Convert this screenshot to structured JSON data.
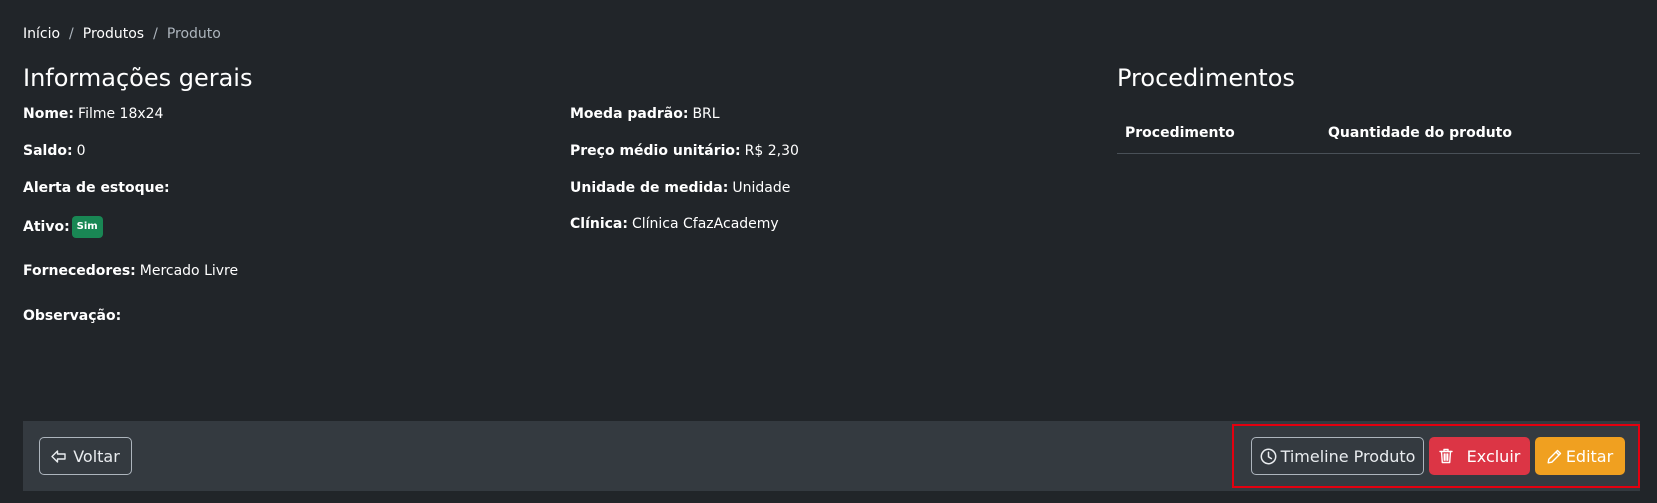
{
  "breadcrumb": {
    "items": [
      "Início",
      "Produtos"
    ],
    "current": "Produto",
    "separator": "/"
  },
  "general": {
    "title": "Informações gerais",
    "fields": {
      "nome": {
        "label": "Nome:",
        "value": "Filme 18x24"
      },
      "saldo": {
        "label": "Saldo:",
        "value": "0"
      },
      "alerta": {
        "label": "Alerta de estoque:",
        "value": ""
      },
      "ativo": {
        "label": "Ativo:",
        "badge": "Sim"
      },
      "fornecedores": {
        "label": "Fornecedores:",
        "value": "Mercado Livre"
      },
      "observacao": {
        "label": "Observação:",
        "value": ""
      },
      "moeda": {
        "label": "Moeda padrão:",
        "value": "BRL"
      },
      "preco": {
        "label": "Preço médio unitário:",
        "value": "R$ 2,30"
      },
      "unidade": {
        "label": "Unidade de medida:",
        "value": "Unidade"
      },
      "clinica": {
        "label": "Clínica:",
        "value": "Clínica CfazAcademy"
      }
    }
  },
  "procedimentos": {
    "title": "Procedimentos",
    "columns": [
      "Procedimento",
      "Quantidade do produto"
    ]
  },
  "footer": {
    "voltar_label": "Voltar",
    "timeline_label": "Timeline Produto",
    "excluir_label": "Excluir",
    "editar_label": "Editar"
  },
  "icons": {
    "voltar": "arrow-left-icon",
    "timeline": "clock-icon",
    "excluir": "trash-icon",
    "editar": "pencil-icon"
  },
  "colors": {
    "background": "#212529",
    "footer": "#343a40",
    "success": "#198754",
    "danger": "#dc3545",
    "warning": "#f0a020",
    "highlight": "#e3000f"
  }
}
